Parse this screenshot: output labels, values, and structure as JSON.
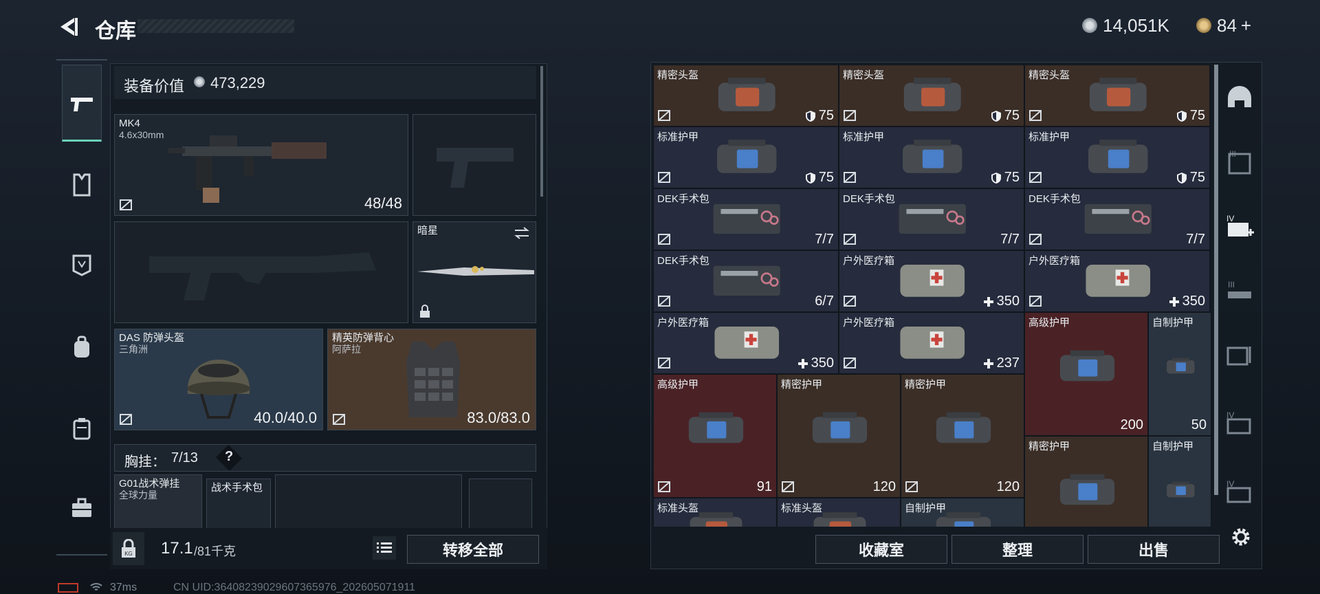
{
  "header": {
    "title": "仓库",
    "currency_primary": "14,051K",
    "currency_secondary": "84",
    "add_label": "+"
  },
  "equipment": {
    "value_label": "装备价值",
    "value": "473,229",
    "primary_weapon": {
      "name": "MK4",
      "ammo_type": "4.6x30mm",
      "count": "48/48"
    },
    "melee": {
      "name": "暗星"
    },
    "helmet": {
      "name": "DAS 防弹头盔",
      "sub": "三角洲",
      "durability": "40.0/40.0"
    },
    "armor": {
      "name": "精英防弹背心",
      "sub": "阿萨拉",
      "durability": "83.0/83.0"
    },
    "chest_rig": {
      "label": "胸挂：",
      "capacity": "7/13",
      "help": "?"
    },
    "rig_items": [
      {
        "name": "G01战术弹挂",
        "sub": "全球力量"
      },
      {
        "name": "战术手术包"
      }
    ],
    "weight": {
      "current": "17.1",
      "max": "/81千克"
    },
    "transfer_all": "转移全部"
  },
  "stash": {
    "rows": [
      [
        {
          "name": "精密头盔",
          "value": "75",
          "icon": "shield-icon",
          "color": "brown"
        },
        {
          "name": "精密头盔",
          "value": "75",
          "icon": "shield-icon",
          "color": "brown"
        },
        {
          "name": "精密头盔",
          "value": "75",
          "icon": "shield-icon",
          "color": "brown"
        }
      ],
      [
        {
          "name": "标准护甲",
          "value": "75",
          "icon": "shield-icon",
          "color": "navy"
        },
        {
          "name": "标准护甲",
          "value": "75",
          "icon": "shield-icon",
          "color": "navy"
        },
        {
          "name": "标准护甲",
          "value": "75",
          "icon": "shield-icon",
          "color": "navy"
        }
      ],
      [
        {
          "name": "DEK手术包",
          "value": "7/7",
          "icon": "",
          "color": "navy"
        },
        {
          "name": "DEK手术包",
          "value": "7/7",
          "icon": "",
          "color": "navy"
        },
        {
          "name": "DEK手术包",
          "value": "7/7",
          "icon": "",
          "color": "navy"
        }
      ],
      [
        {
          "name": "DEK手术包",
          "value": "6/7",
          "icon": "",
          "color": "navy"
        },
        {
          "name": "户外医疗箱",
          "value": "350",
          "icon": "plus-icon",
          "color": "navy"
        },
        {
          "name": "户外医疗箱",
          "value": "350",
          "icon": "plus-icon",
          "color": "navy"
        }
      ],
      [
        {
          "name": "户外医疗箱",
          "value": "350",
          "icon": "plus-icon",
          "color": "navy"
        },
        {
          "name": "户外医疗箱",
          "value": "237",
          "icon": "plus-icon",
          "color": "navy"
        }
      ]
    ],
    "big_items": [
      {
        "name": "高级护甲",
        "value": "91",
        "color": "maroon"
      },
      {
        "name": "精密护甲",
        "value": "120",
        "color": "brown"
      },
      {
        "name": "精密护甲",
        "value": "120",
        "color": "brown"
      }
    ],
    "right_col": [
      {
        "name": "高级护甲",
        "value": "200",
        "color": "maroon"
      },
      {
        "name": "自制护甲",
        "value": "50",
        "color": "bluegray"
      },
      {
        "name": "精密护甲",
        "value": "",
        "color": "brown"
      },
      {
        "name": "自制护甲",
        "value": "",
        "color": "bluegray"
      }
    ],
    "bottom_partial": [
      "标准头盔",
      "标准头盔",
      "自制护甲"
    ],
    "buttons": {
      "collection": "收藏室",
      "organize": "整理",
      "sell": "出售"
    }
  },
  "status": {
    "ping": "37ms",
    "uid": "CN UID:3640823902960736597​6_202605071911"
  }
}
